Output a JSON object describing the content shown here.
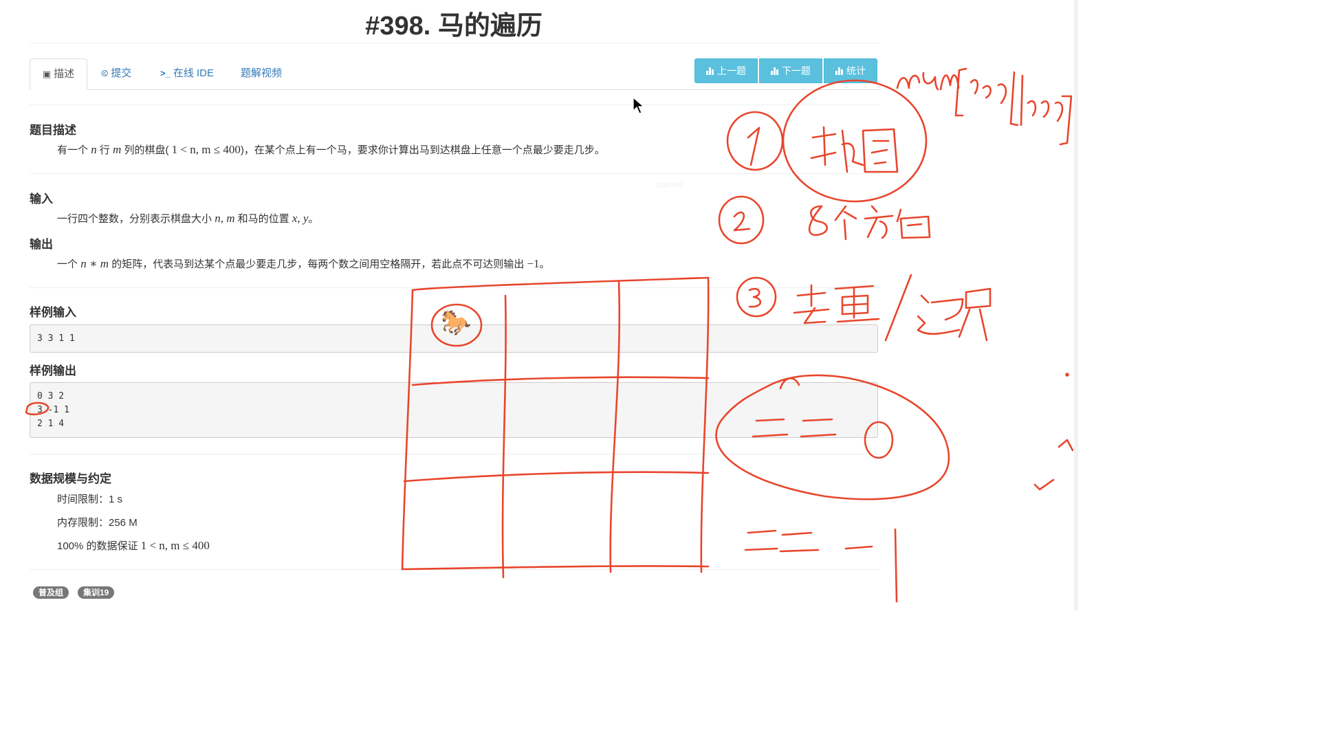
{
  "title": "#398. 马的遍历",
  "tabs": [
    {
      "label": "描述",
      "icon": "book-icon",
      "active": true
    },
    {
      "label": "提交",
      "icon": "upload-circle-icon"
    },
    {
      "label": "在线 IDE",
      "icon": "terminal-icon"
    },
    {
      "label": "题解视频",
      "icon": ""
    }
  ],
  "toolbar": {
    "prev": "上一题",
    "next": "下一题",
    "stats": "统计",
    "color": "#5bc0de"
  },
  "description": {
    "heading": "题目描述",
    "text_a": "有一个",
    "var_n": "n",
    "text_b": "行",
    "var_m": "m",
    "text_c": "列的棋盘(",
    "constraint": "1 < n, m ≤ 400",
    "text_d": ")，在某个点上有一个马，要求你计算出马到达棋盘上任意一个点最少要走几步。"
  },
  "input": {
    "heading": "输入",
    "text_a": "一行四个整数，分别表示棋盘大小",
    "vars_nm": "n, m",
    "text_b": "和马的位置",
    "vars_xy": "x, y",
    "text_c": "。"
  },
  "output": {
    "heading": "输出",
    "text_a": "一个",
    "expr": "n ∗ m",
    "text_b": "的矩阵，代表马到达某个点最少要走几步，每两个数之间用空格隔开，若此点不可达则输出",
    "neg": "−1",
    "text_c": "。"
  },
  "sample_input": {
    "heading": "样例输入",
    "lines": [
      "3 3 1 1"
    ]
  },
  "sample_output": {
    "heading": "样例输出",
    "lines": [
      "0 3 2",
      "3 -1 1",
      "2 1 4"
    ]
  },
  "limits": {
    "heading": "数据规模与约定",
    "time": "时间限制：1 s",
    "memory": "内存限制：256 M",
    "data_a": "100% 的数据保证",
    "data_constraint": "1 < n, m ≤ 400"
  },
  "tags": [
    "普及组",
    "集训19"
  ],
  "watermark": "ccp4166",
  "annotation": {
    "ink_color": "#e8452c",
    "horse_emoji": "🐎"
  }
}
